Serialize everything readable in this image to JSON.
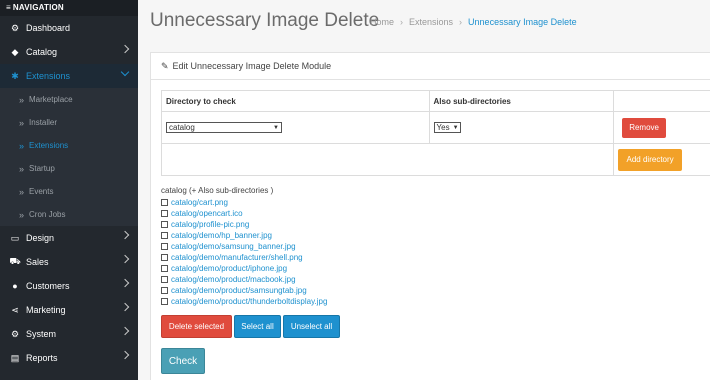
{
  "sidebar": {
    "header": "NAVIGATION",
    "items": [
      {
        "label": "Dashboard",
        "icon": "dashboard-icon",
        "glyph": "⚙"
      },
      {
        "label": "Catalog",
        "icon": "tag-icon",
        "glyph": "◆"
      },
      {
        "label": "Extensions",
        "icon": "puzzle-icon",
        "glyph": "✱"
      },
      {
        "label": "Design",
        "icon": "monitor-icon",
        "glyph": "▭"
      },
      {
        "label": "Sales",
        "icon": "cart-icon",
        "glyph": "⛟"
      },
      {
        "label": "Customers",
        "icon": "user-icon",
        "glyph": "●"
      },
      {
        "label": "Marketing",
        "icon": "share-icon",
        "glyph": "⋖"
      },
      {
        "label": "System",
        "icon": "gear-icon",
        "glyph": "⚙"
      },
      {
        "label": "Reports",
        "icon": "bar-chart-icon",
        "glyph": "▤"
      }
    ],
    "sub_items": [
      "Marketplace",
      "Installer",
      "Extensions",
      "Startup",
      "Events",
      "Cron Jobs"
    ]
  },
  "header": {
    "title": "Unnecessary Image Delete",
    "breadcrumb": [
      "Home",
      "Extensions",
      "Unnecessary Image Delete"
    ]
  },
  "panel": {
    "heading": "Edit Unnecessary Image Delete Module",
    "table": {
      "col_directory": "Directory to check",
      "col_subdirs": "Also sub-directories",
      "directory_value": "catalog",
      "subdirs_value": "Yes",
      "remove_label": "Remove",
      "add_label": "Add directory"
    },
    "list_title": "catalog (+ Also sub-directories )",
    "files": [
      "catalog/cart.png",
      "catalog/opencart.ico",
      "catalog/profile-pic.png",
      "catalog/demo/hp_banner.jpg",
      "catalog/demo/samsung_banner.jpg",
      "catalog/demo/manufacturer/shell.png",
      "catalog/demo/product/iphone.jpg",
      "catalog/demo/product/macbook.jpg",
      "catalog/demo/product/samsungtab.jpg",
      "catalog/demo/product/thunderboltdisplay.jpg"
    ],
    "delete_selected": "Delete selected",
    "select_all": "Select all",
    "unselect_all": "Unselect all",
    "check": "Check"
  },
  "colors": {
    "accent": "#1e91cf",
    "danger": "#e04b3d",
    "warning": "#f2a128",
    "info": "#4aa0b5",
    "sidebar": "#23282e"
  }
}
